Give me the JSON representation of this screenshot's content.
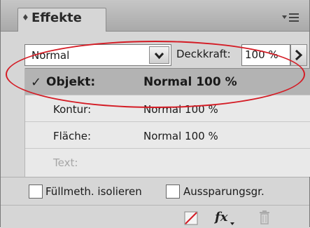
{
  "panel": {
    "tab_label": "Effekte",
    "tab_icon": "double-arrow-icon",
    "menu_icon": "panel-menu-icon"
  },
  "controls": {
    "blend_mode": "Normal",
    "opacity_label": "Deckkraft:",
    "opacity_value": "100 %"
  },
  "rows": [
    {
      "name": "Objekt:",
      "value": "Normal 100 %",
      "selected": true
    },
    {
      "name": "Kontur:",
      "value": "Normal 100 %"
    },
    {
      "name": "Fläche:",
      "value": "Normal 100 %"
    },
    {
      "name": "Text:",
      "value": "",
      "disabled": true
    }
  ],
  "options": {
    "isolate_label": "Füllmeth. isolieren",
    "knockout_label": "Aussparungsgr."
  },
  "bottom_icons": [
    "clear-effects-icon",
    "fx-icon",
    "trash-icon"
  ],
  "colors": {
    "highlight_ellipse": "#d41c25",
    "selected_row": "#b3b3b3"
  }
}
